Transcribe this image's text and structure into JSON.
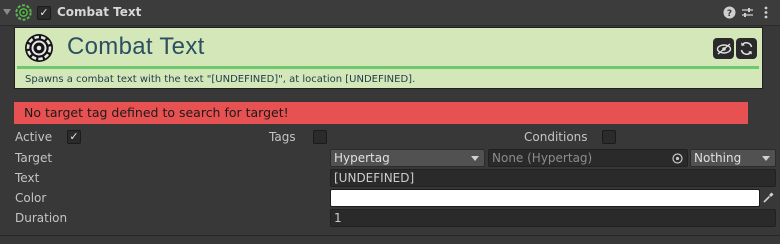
{
  "component": {
    "title": "Combat Text",
    "enabled": true
  },
  "banner": {
    "title": "Combat Text",
    "description": "Spawns a combat text with the text \"[UNDEFINED]\", at location [UNDEFINED].",
    "background_color": "#d3e7b9",
    "accent_color": "#70c86e"
  },
  "error": {
    "message": "No target tag defined to search for target!",
    "color": "#e75151"
  },
  "options": {
    "active_label": "Active",
    "active_checked": true,
    "tags_label": "Tags",
    "tags_checked": false,
    "conditions_label": "Conditions",
    "conditions_checked": false
  },
  "fields": {
    "target_label": "Target",
    "target_type": "Hypertag",
    "target_object": "None (Hypertag)",
    "target_mode": "Nothing",
    "text_label": "Text",
    "text_value": "[UNDEFINED]",
    "color_label": "Color",
    "color_value": "#ffffff",
    "duration_label": "Duration",
    "duration_value": "1"
  },
  "icons": {
    "fold": "triangle-down-icon",
    "component": "gear-target-icon",
    "help": "question-icon",
    "presets": "sliders-icon",
    "menu": "kebab-menu-icon",
    "hide": "eye-slash-icon",
    "refresh": "refresh-icon",
    "picker": "target-picker-icon",
    "eyedropper": "eyedropper-icon"
  }
}
